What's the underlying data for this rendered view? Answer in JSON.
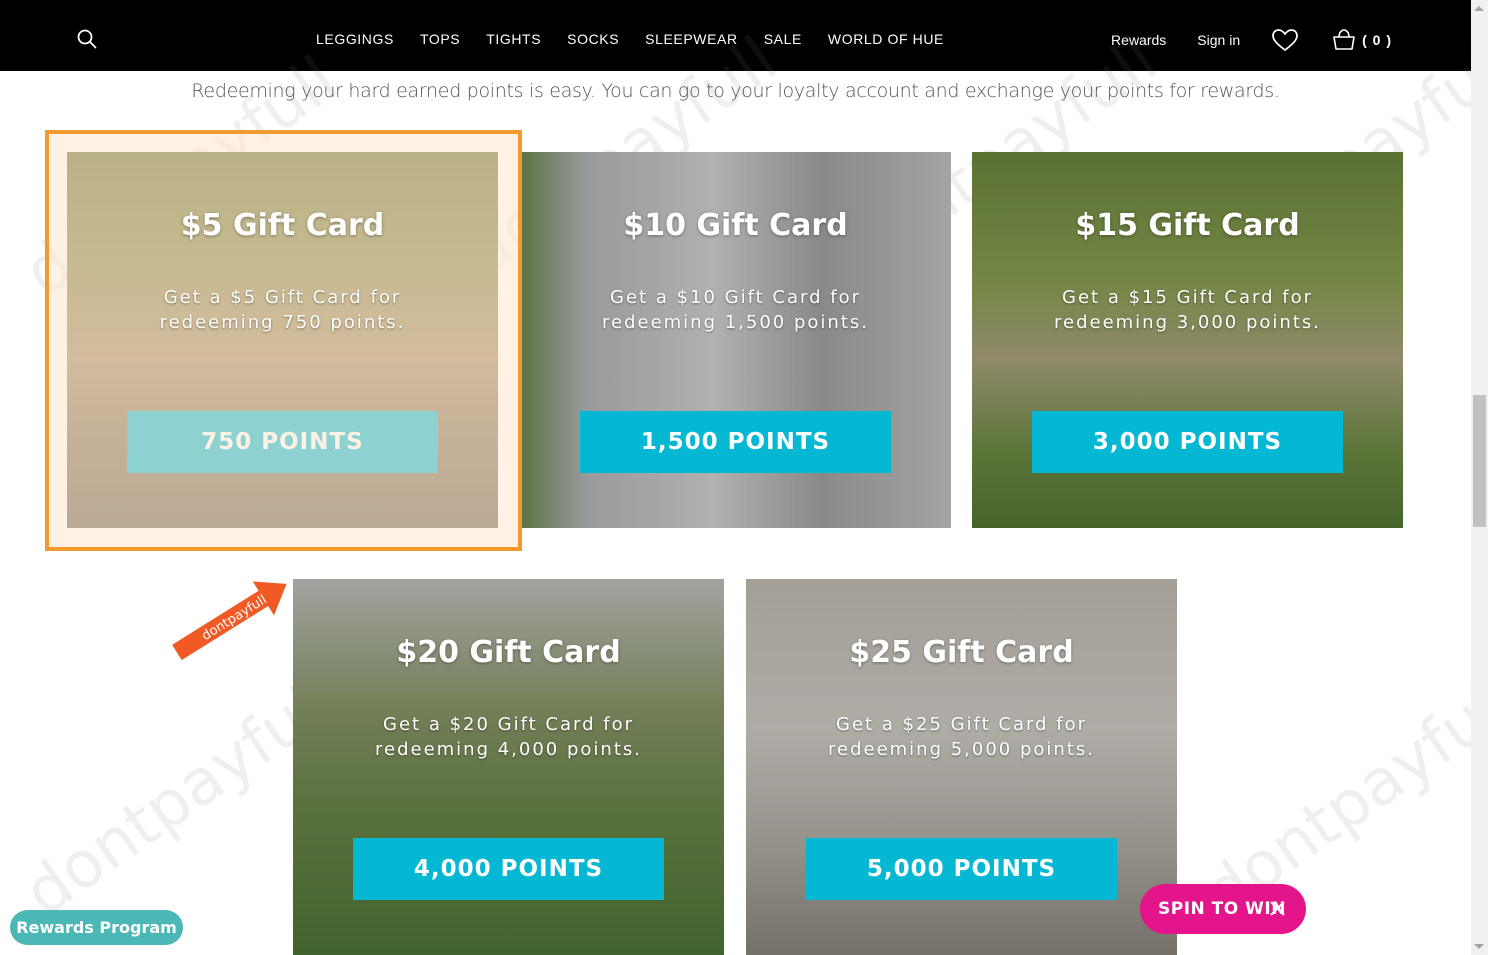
{
  "header": {
    "nav": [
      "LEGGINGS",
      "TOPS",
      "TIGHTS",
      "SOCKS",
      "SLEEPWEAR",
      "SALE",
      "WORLD OF HUE"
    ],
    "rewards_label": "Rewards",
    "sign_in_label": "Sign in",
    "cart_count": "( 0 )",
    "icons": [
      "search-icon",
      "heart-icon",
      "cart-icon"
    ]
  },
  "intro_text": "Redeeming your hard earned points is easy. You can go to your loyalty account and exchange your points for rewards.",
  "cards": [
    {
      "title": "$5 Gift Card",
      "desc_line1": "Get a $5 Gift Card for",
      "desc_line2": "redeeming 750 points.",
      "points": "750 POINTS"
    },
    {
      "title": "$10 Gift Card",
      "desc_line1": "Get a $10 Gift Card for",
      "desc_line2": "redeeming 1,500 points.",
      "points": "1,500 POINTS"
    },
    {
      "title": "$15 Gift Card",
      "desc_line1": "Get a $15 Gift Card for",
      "desc_line2": "redeeming 3,000 points.",
      "points": "3,000 POINTS"
    },
    {
      "title": "$20 Gift Card",
      "desc_line1": "Get a $20 Gift Card for",
      "desc_line2": "redeeming 4,000 points.",
      "points": "4,000 POINTS"
    },
    {
      "title": "$25 Gift Card",
      "desc_line1": "Get a $25 Gift Card for",
      "desc_line2": "redeeming 5,000 points.",
      "points": "5,000 POINTS"
    }
  ],
  "watermark": "dontpayfull",
  "rewards_program_label": "Rewards Program",
  "spin_label": "SPIN TO WIN",
  "colors": {
    "header_bg": "#000000",
    "points_button": "#04b8d4",
    "highlight": "#f39a2e",
    "rewards_program": "#4cb8b6",
    "spin": "#e4158a"
  }
}
